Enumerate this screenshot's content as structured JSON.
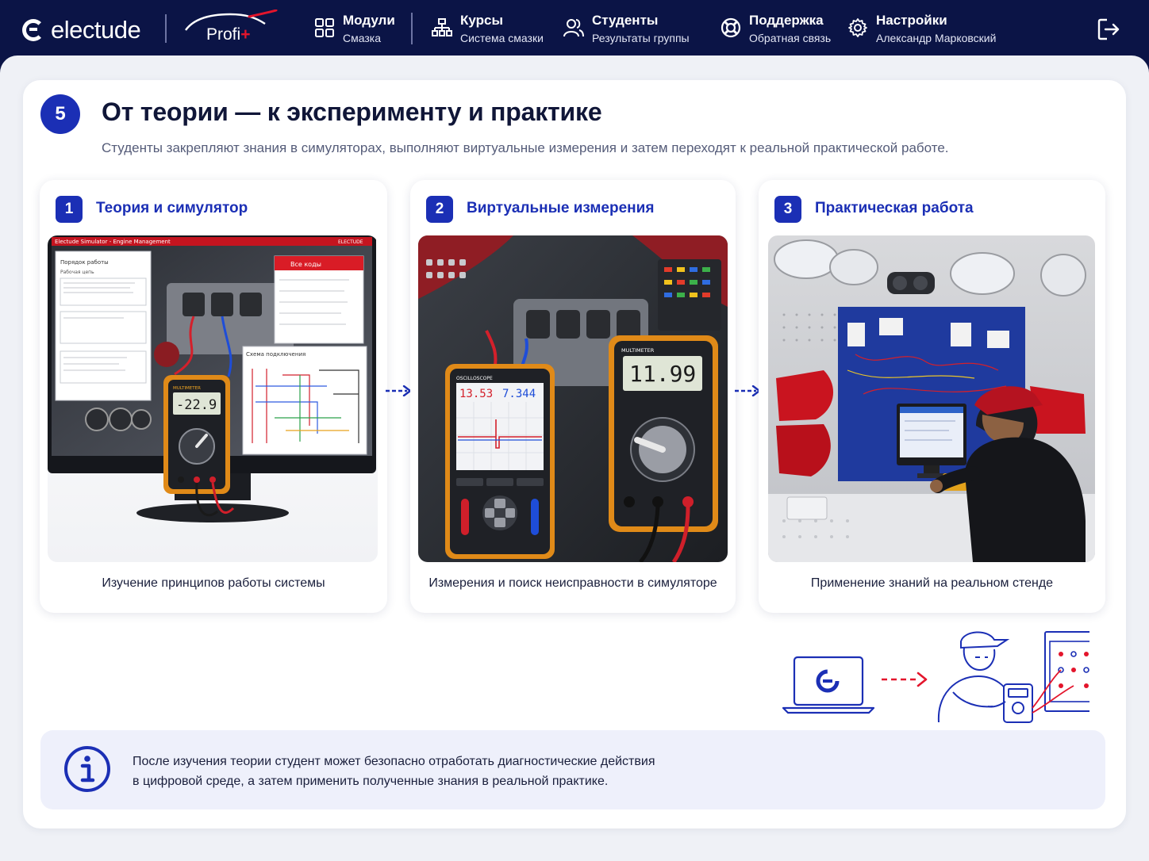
{
  "brand": {
    "name": "electude",
    "product": "Profi",
    "product_mark": "+"
  },
  "nav": {
    "modules": {
      "title": "Модули",
      "sub": "Смазка"
    },
    "courses": {
      "title": "Курсы",
      "sub": "Система смазки"
    },
    "students": {
      "title": "Студенты",
      "sub": "Результаты группы"
    },
    "support": {
      "title": "Поддержка",
      "sub": "Обратная связь"
    },
    "settings": {
      "title": "Настройки",
      "sub": "Александр Марковский"
    }
  },
  "section": {
    "number": "5",
    "title": "От теории — к эксперименту и практике",
    "subtitle": "Студенты закрепляют знания в симуляторах, выполняют виртуальные измерения и затем переходят к реальной практической работе."
  },
  "cards": [
    {
      "number": "1",
      "title": "Теория и симулятор",
      "caption": "Изучение принципов работы системы",
      "screen": {
        "window_title": "Electude Simulator - Engine Management",
        "window_logo": "ELECTUDE",
        "panel_title": "Порядок работы",
        "panel_sub": "Рабочая цепь",
        "codes_title": "Все коды",
        "diagram_title": "Схема подключения",
        "meter_label": "MULTIMETER",
        "meter_reading": "-22.9"
      }
    },
    {
      "number": "2",
      "title": "Виртуальные измерения",
      "caption": "Измерения и поиск неисправности в симуляторе",
      "screen": {
        "scope_label": "OSCILLOSCOPE",
        "scope_value_1": "13.53",
        "scope_value_2": "7.344",
        "meter_label": "MULTIMETER",
        "meter_reading": "11.99"
      }
    },
    {
      "number": "3",
      "title": "Практическая работа",
      "caption": "Применение знаний на реальном стенде"
    }
  ],
  "info": {
    "line1": "После изучения теории студент может безопасно отработать диагностические действия",
    "line2": "в цифровой среде, а затем применить полученные знания в реальной практике."
  },
  "colors": {
    "navy": "#0b1446",
    "accent_blue": "#1b2fb5",
    "accent_red": "#e3152c",
    "page_bg": "#eff1f6",
    "info_bg": "#eef0fb"
  },
  "icons": {
    "modules": "grid-icon",
    "courses": "hierarchy-icon",
    "students": "users-icon",
    "support": "lifebuoy-icon",
    "settings": "gear-icon",
    "logout": "logout-icon",
    "info": "info-icon"
  }
}
